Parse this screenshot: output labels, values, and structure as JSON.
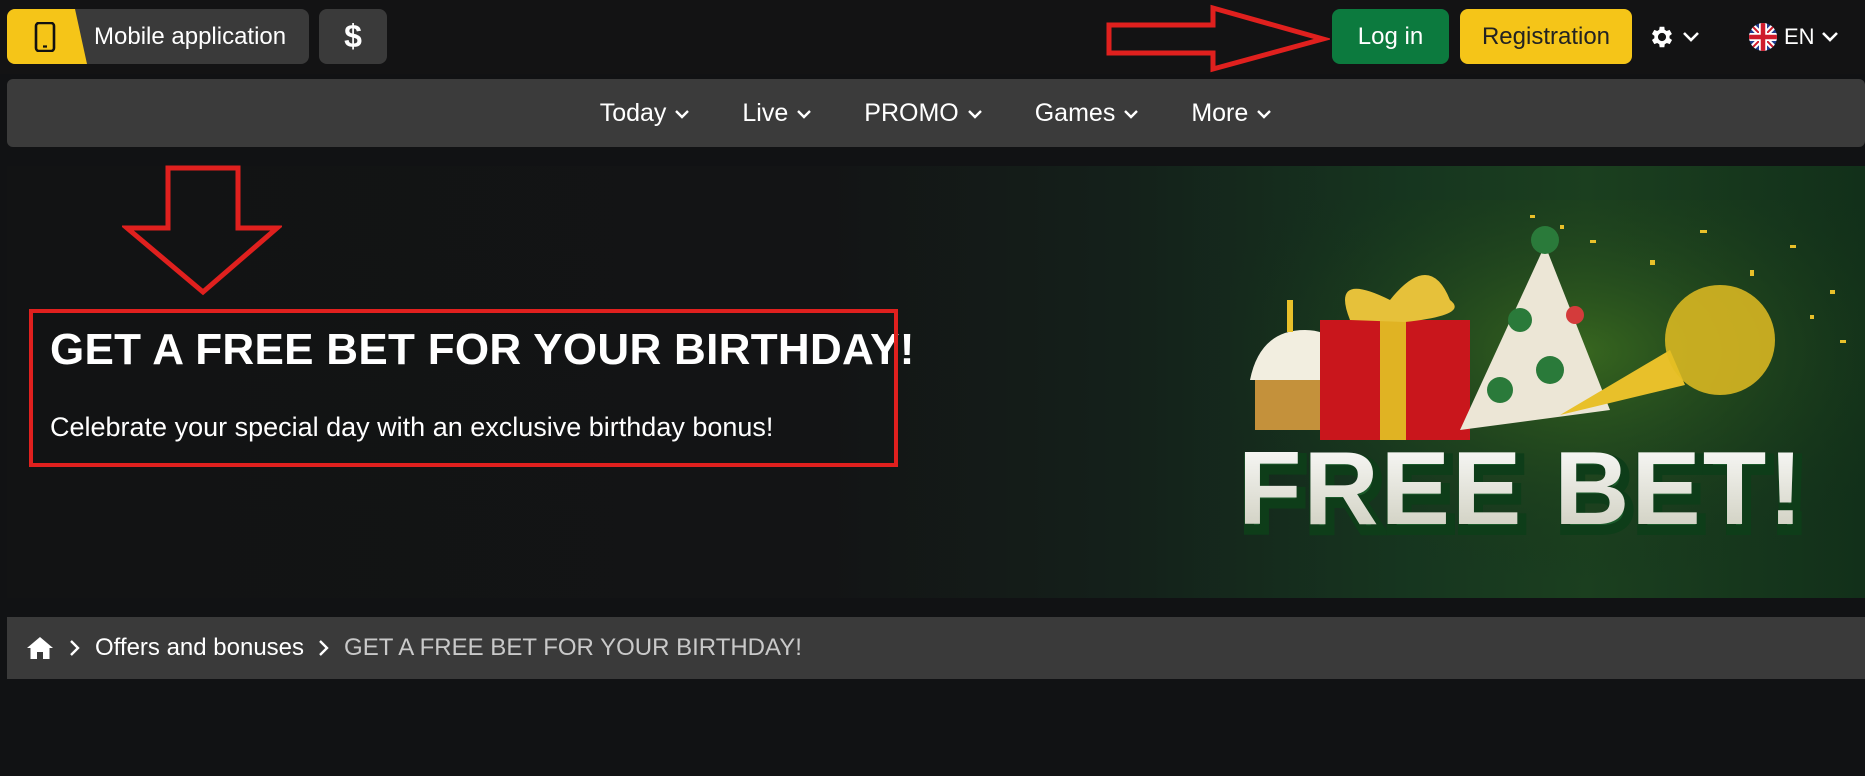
{
  "topbar": {
    "mobile_app_label": "Mobile application",
    "dollar_symbol": "$",
    "login_label": "Log in",
    "registration_label": "Registration",
    "language_code": "EN"
  },
  "nav": {
    "items": [
      {
        "label": "Today"
      },
      {
        "label": "Live"
      },
      {
        "label": "PROMO"
      },
      {
        "label": "Games"
      },
      {
        "label": "More"
      }
    ]
  },
  "banner": {
    "title": "GET A FREE BET FOR YOUR BIRTHDAY!",
    "subtitle": "Celebrate your special day with an exclusive birthday bonus!",
    "art_text": "FREE BET!"
  },
  "breadcrumb": {
    "offers_label": "Offers and bonuses",
    "current_label": "GET A FREE BET FOR YOUR BIRTHDAY!"
  },
  "colors": {
    "accent_yellow": "#f5c518",
    "login_green": "#0c7a3e",
    "annotation_red": "#e0201e",
    "background": "#111214",
    "panel": "#3a3a3a"
  },
  "icons": [
    "phone-icon",
    "gear-icon",
    "chevron-down-icon",
    "uk-flag-icon",
    "home-icon",
    "chevron-right-icon"
  ]
}
